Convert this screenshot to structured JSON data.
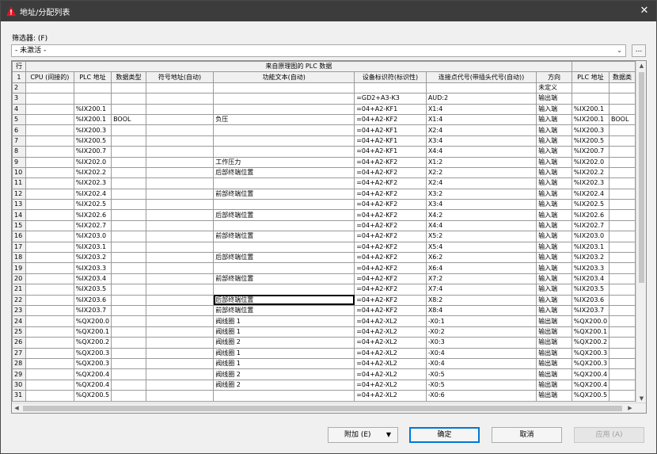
{
  "window": {
    "title": "地址/分配列表",
    "close_glyph": "✕"
  },
  "filter": {
    "label": "筛选器: (F)",
    "value": "- 未激活 -",
    "more_label": "..."
  },
  "grid": {
    "corner_label": "行",
    "group_header": "来自原理图的 PLC 数据",
    "header_row_num": "1",
    "columns": [
      "CPU (间接的)",
      "PLC 地址",
      "数据类型",
      "符号地址(自动)",
      "功能文本(自动)",
      "设备标识符(标识性)",
      "连接点代号(带插头代号(自动))",
      "方向",
      "PLC 地址",
      "数据类"
    ],
    "rows": [
      {
        "n": "2",
        "cpu": "",
        "plc": "",
        "type": "",
        "sym": "",
        "func": "",
        "dev": "",
        "conn": "",
        "dir": "未定义",
        "plc2": "",
        "type2": ""
      },
      {
        "n": "3",
        "cpu": "",
        "plc": "",
        "type": "",
        "sym": "",
        "func": "",
        "dev": "=GD2+A3-K3",
        "conn": "AUD:2",
        "dir": "输出端",
        "plc2": "",
        "type2": ""
      },
      {
        "n": "4",
        "cpu": "",
        "plc": "%IX200.1",
        "type": "",
        "sym": "",
        "func": "",
        "dev": "=04+A2-KF1",
        "conn": "X1:4",
        "dir": "输入端",
        "plc2": "%IX200.1",
        "type2": ""
      },
      {
        "n": "5",
        "cpu": "",
        "plc": "%IX200.1",
        "type": "BOOL",
        "sym": "",
        "func": "负压",
        "dev": "=04+A2-KF2",
        "conn": "X1:4",
        "dir": "输入端",
        "plc2": "%IX200.1",
        "type2": "BOOL"
      },
      {
        "n": "6",
        "cpu": "",
        "plc": "%IX200.3",
        "type": "",
        "sym": "",
        "func": "",
        "dev": "=04+A2-KF1",
        "conn": "X2:4",
        "dir": "输入端",
        "plc2": "%IX200.3",
        "type2": ""
      },
      {
        "n": "7",
        "cpu": "",
        "plc": "%IX200.5",
        "type": "",
        "sym": "",
        "func": "",
        "dev": "=04+A2-KF1",
        "conn": "X3:4",
        "dir": "输入端",
        "plc2": "%IX200.5",
        "type2": ""
      },
      {
        "n": "8",
        "cpu": "",
        "plc": "%IX200.7",
        "type": "",
        "sym": "",
        "func": "",
        "dev": "=04+A2-KF1",
        "conn": "X4:4",
        "dir": "输入端",
        "plc2": "%IX200.7",
        "type2": ""
      },
      {
        "n": "9",
        "cpu": "",
        "plc": "%IX202.0",
        "type": "",
        "sym": "",
        "func": "工作压力",
        "dev": "=04+A2-KF2",
        "conn": "X1:2",
        "dir": "输入端",
        "plc2": "%IX202.0",
        "type2": ""
      },
      {
        "n": "10",
        "cpu": "",
        "plc": "%IX202.2",
        "type": "",
        "sym": "",
        "func": "后部终端位置",
        "dev": "=04+A2-KF2",
        "conn": "X2:2",
        "dir": "输入端",
        "plc2": "%IX202.2",
        "type2": ""
      },
      {
        "n": "11",
        "cpu": "",
        "plc": "%IX202.3",
        "type": "",
        "sym": "",
        "func": "",
        "dev": "=04+A2-KF2",
        "conn": "X2:4",
        "dir": "输入端",
        "plc2": "%IX202.3",
        "type2": ""
      },
      {
        "n": "12",
        "cpu": "",
        "plc": "%IX202.4",
        "type": "",
        "sym": "",
        "func": "前部终端位置",
        "dev": "=04+A2-KF2",
        "conn": "X3:2",
        "dir": "输入端",
        "plc2": "%IX202.4",
        "type2": ""
      },
      {
        "n": "13",
        "cpu": "",
        "plc": "%IX202.5",
        "type": "",
        "sym": "",
        "func": "",
        "dev": "=04+A2-KF2",
        "conn": "X3:4",
        "dir": "输入端",
        "plc2": "%IX202.5",
        "type2": ""
      },
      {
        "n": "14",
        "cpu": "",
        "plc": "%IX202.6",
        "type": "",
        "sym": "",
        "func": "后部终端位置",
        "dev": "=04+A2-KF2",
        "conn": "X4:2",
        "dir": "输入端",
        "plc2": "%IX202.6",
        "type2": ""
      },
      {
        "n": "15",
        "cpu": "",
        "plc": "%IX202.7",
        "type": "",
        "sym": "",
        "func": "",
        "dev": "=04+A2-KF2",
        "conn": "X4:4",
        "dir": "输入端",
        "plc2": "%IX202.7",
        "type2": ""
      },
      {
        "n": "16",
        "cpu": "",
        "plc": "%IX203.0",
        "type": "",
        "sym": "",
        "func": "前部终端位置",
        "dev": "=04+A2-KF2",
        "conn": "X5:2",
        "dir": "输入端",
        "plc2": "%IX203.0",
        "type2": ""
      },
      {
        "n": "17",
        "cpu": "",
        "plc": "%IX203.1",
        "type": "",
        "sym": "",
        "func": "",
        "dev": "=04+A2-KF2",
        "conn": "X5:4",
        "dir": "输入端",
        "plc2": "%IX203.1",
        "type2": ""
      },
      {
        "n": "18",
        "cpu": "",
        "plc": "%IX203.2",
        "type": "",
        "sym": "",
        "func": "后部终端位置",
        "dev": "=04+A2-KF2",
        "conn": "X6:2",
        "dir": "输入端",
        "plc2": "%IX203.2",
        "type2": ""
      },
      {
        "n": "19",
        "cpu": "",
        "plc": "%IX203.3",
        "type": "",
        "sym": "",
        "func": "",
        "dev": "=04+A2-KF2",
        "conn": "X6:4",
        "dir": "输入端",
        "plc2": "%IX203.3",
        "type2": ""
      },
      {
        "n": "20",
        "cpu": "",
        "plc": "%IX203.4",
        "type": "",
        "sym": "",
        "func": "前部终端位置",
        "dev": "=04+A2-KF2",
        "conn": "X7:2",
        "dir": "输入端",
        "plc2": "%IX203.4",
        "type2": ""
      },
      {
        "n": "21",
        "cpu": "",
        "plc": "%IX203.5",
        "type": "",
        "sym": "",
        "func": "",
        "dev": "=04+A2-KF2",
        "conn": "X7:4",
        "dir": "输入端",
        "plc2": "%IX203.5",
        "type2": ""
      },
      {
        "n": "22",
        "cpu": "",
        "plc": "%IX203.6",
        "type": "",
        "sym": "",
        "func": "后部终端位置",
        "dev": "=04+A2-KF2",
        "conn": "X8:2",
        "dir": "输入端",
        "plc2": "%IX203.6",
        "type2": "",
        "selected": true
      },
      {
        "n": "23",
        "cpu": "",
        "plc": "%IX203.7",
        "type": "",
        "sym": "",
        "func": "前部终端位置",
        "dev": "=04+A2-KF2",
        "conn": "X8:4",
        "dir": "输入端",
        "plc2": "%IX203.7",
        "type2": ""
      },
      {
        "n": "24",
        "cpu": "",
        "plc": "%QX200.0",
        "type": "",
        "sym": "",
        "func": "阀线圈 1",
        "dev": "=04+A2-XL2",
        "conn": "-X0:1",
        "dir": "输出端",
        "plc2": "%QX200.0",
        "type2": ""
      },
      {
        "n": "25",
        "cpu": "",
        "plc": "%QX200.1",
        "type": "",
        "sym": "",
        "func": "阀线圈 1",
        "dev": "=04+A2-XL2",
        "conn": "-X0:2",
        "dir": "输出端",
        "plc2": "%QX200.1",
        "type2": ""
      },
      {
        "n": "26",
        "cpu": "",
        "plc": "%QX200.2",
        "type": "",
        "sym": "",
        "func": "阀线圈 2",
        "dev": "=04+A2-XL2",
        "conn": "-X0:3",
        "dir": "输出端",
        "plc2": "%QX200.2",
        "type2": ""
      },
      {
        "n": "27",
        "cpu": "",
        "plc": "%QX200.3",
        "type": "",
        "sym": "",
        "func": "阀线圈 1",
        "dev": "=04+A2-XL2",
        "conn": "-X0:4",
        "dir": "输出端",
        "plc2": "%QX200.3",
        "type2": ""
      },
      {
        "n": "28",
        "cpu": "",
        "plc": "%QX200.3",
        "type": "",
        "sym": "",
        "func": "阀线圈 1",
        "dev": "=04+A2-XL2",
        "conn": "-X0:4",
        "dir": "输出端",
        "plc2": "%QX200.3",
        "type2": ""
      },
      {
        "n": "29",
        "cpu": "",
        "plc": "%QX200.4",
        "type": "",
        "sym": "",
        "func": "阀线圈 2",
        "dev": "=04+A2-XL2",
        "conn": "-X0:5",
        "dir": "输出端",
        "plc2": "%QX200.4",
        "type2": ""
      },
      {
        "n": "30",
        "cpu": "",
        "plc": "%QX200.4",
        "type": "",
        "sym": "",
        "func": "阀线圈 2",
        "dev": "=04+A2-XL2",
        "conn": "-X0:5",
        "dir": "输出端",
        "plc2": "%QX200.4",
        "type2": ""
      },
      {
        "n": "31",
        "cpu": "",
        "plc": "%QX200.5",
        "type": "",
        "sym": "",
        "func": "",
        "dev": "=04+A2-XL2",
        "conn": "-X0:6",
        "dir": "输出端",
        "plc2": "%QX200.5",
        "type2": ""
      }
    ]
  },
  "buttons": {
    "extra": "附加 (E)",
    "ok": "确定",
    "cancel": "取消",
    "apply": "应用 (A)"
  },
  "colors": {
    "titlebar": "#3c3c3c",
    "accent": "#0078d7",
    "warning_icon": "#e81123"
  },
  "icons": {
    "app": "warning-triangle-icon",
    "close": "close-icon",
    "dropdown": "chevron-down-icon",
    "extra_dropdown": "caret-down-icon"
  }
}
